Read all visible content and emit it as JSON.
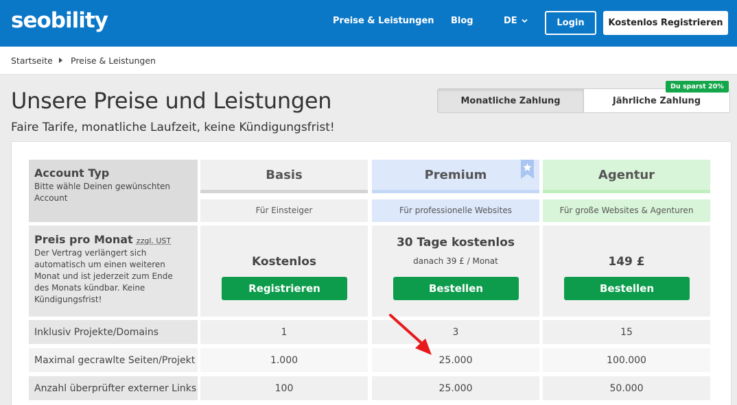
{
  "header": {
    "logo": "seobility",
    "nav": [
      "Preise & Leistungen",
      "Blog"
    ],
    "lang": "DE",
    "login": "Login",
    "register": "Kostenlos Registrieren"
  },
  "breadcrumb": [
    "Startseite",
    "Preise & Leistungen"
  ],
  "page": {
    "title": "Unsere Preise und Leistungen",
    "subtitle": "Faire Tarife, monatliche Laufzeit, keine Kündigungsfrist!"
  },
  "billing_toggle": {
    "monthly": "Monatliche Zahlung",
    "yearly": "Jährliche Zahlung",
    "badge": "Du sparst 20%",
    "selected": "monthly"
  },
  "account": {
    "title": "Account Typ",
    "desc": "Bitte wähle Deinen gewünschten Account"
  },
  "plans": [
    {
      "name": "Basis",
      "sub": "Für Einsteiger",
      "price": "Kostenlos",
      "price_note": "",
      "cta": "Registrieren",
      "accent": "#d4d4d4",
      "bg": "#f0f0f0"
    },
    {
      "name": "Premium",
      "sub": "Für professionelle Websites",
      "price": "30 Tage kostenlos",
      "price_note": "danach 39 £ / Monat",
      "cta": "Bestellen",
      "accent": "#c3d8f7",
      "bg": "#dde8fb"
    },
    {
      "name": "Agentur",
      "sub": "Für große Websites & Agenturen",
      "price": "149 £",
      "price_note": "",
      "cta": "Bestellen",
      "accent": "#bfeebf",
      "bg": "#d9f5d9"
    }
  ],
  "price_row": {
    "title": "Preis pro Monat",
    "ust": "zzgl. UST",
    "desc": "Der Vertrag verlängert sich automatisch um einen weiteren Monat und ist jederzeit zum Ende des Monats kündbar. Keine Kündigungsfrist!"
  },
  "features": [
    {
      "label": "Inklusiv Projekte/Domains",
      "values": [
        "1",
        "3",
        "15"
      ]
    },
    {
      "label": "Maximal gecrawlte Seiten/Projekt",
      "values": [
        "1.000",
        "25.000",
        "100.000"
      ]
    },
    {
      "label": "Anzahl überprüfter externer Links",
      "values": [
        "100",
        "25.000",
        "50.000"
      ]
    }
  ],
  "colors": {
    "brand": "#0a77c7",
    "cta": "#0d9c4c",
    "annotation_arrow": "#e8191b"
  },
  "icons": [
    "chevron-down-icon",
    "caret-right-icon",
    "star-bookmark-icon",
    "red-arrow-icon"
  ]
}
